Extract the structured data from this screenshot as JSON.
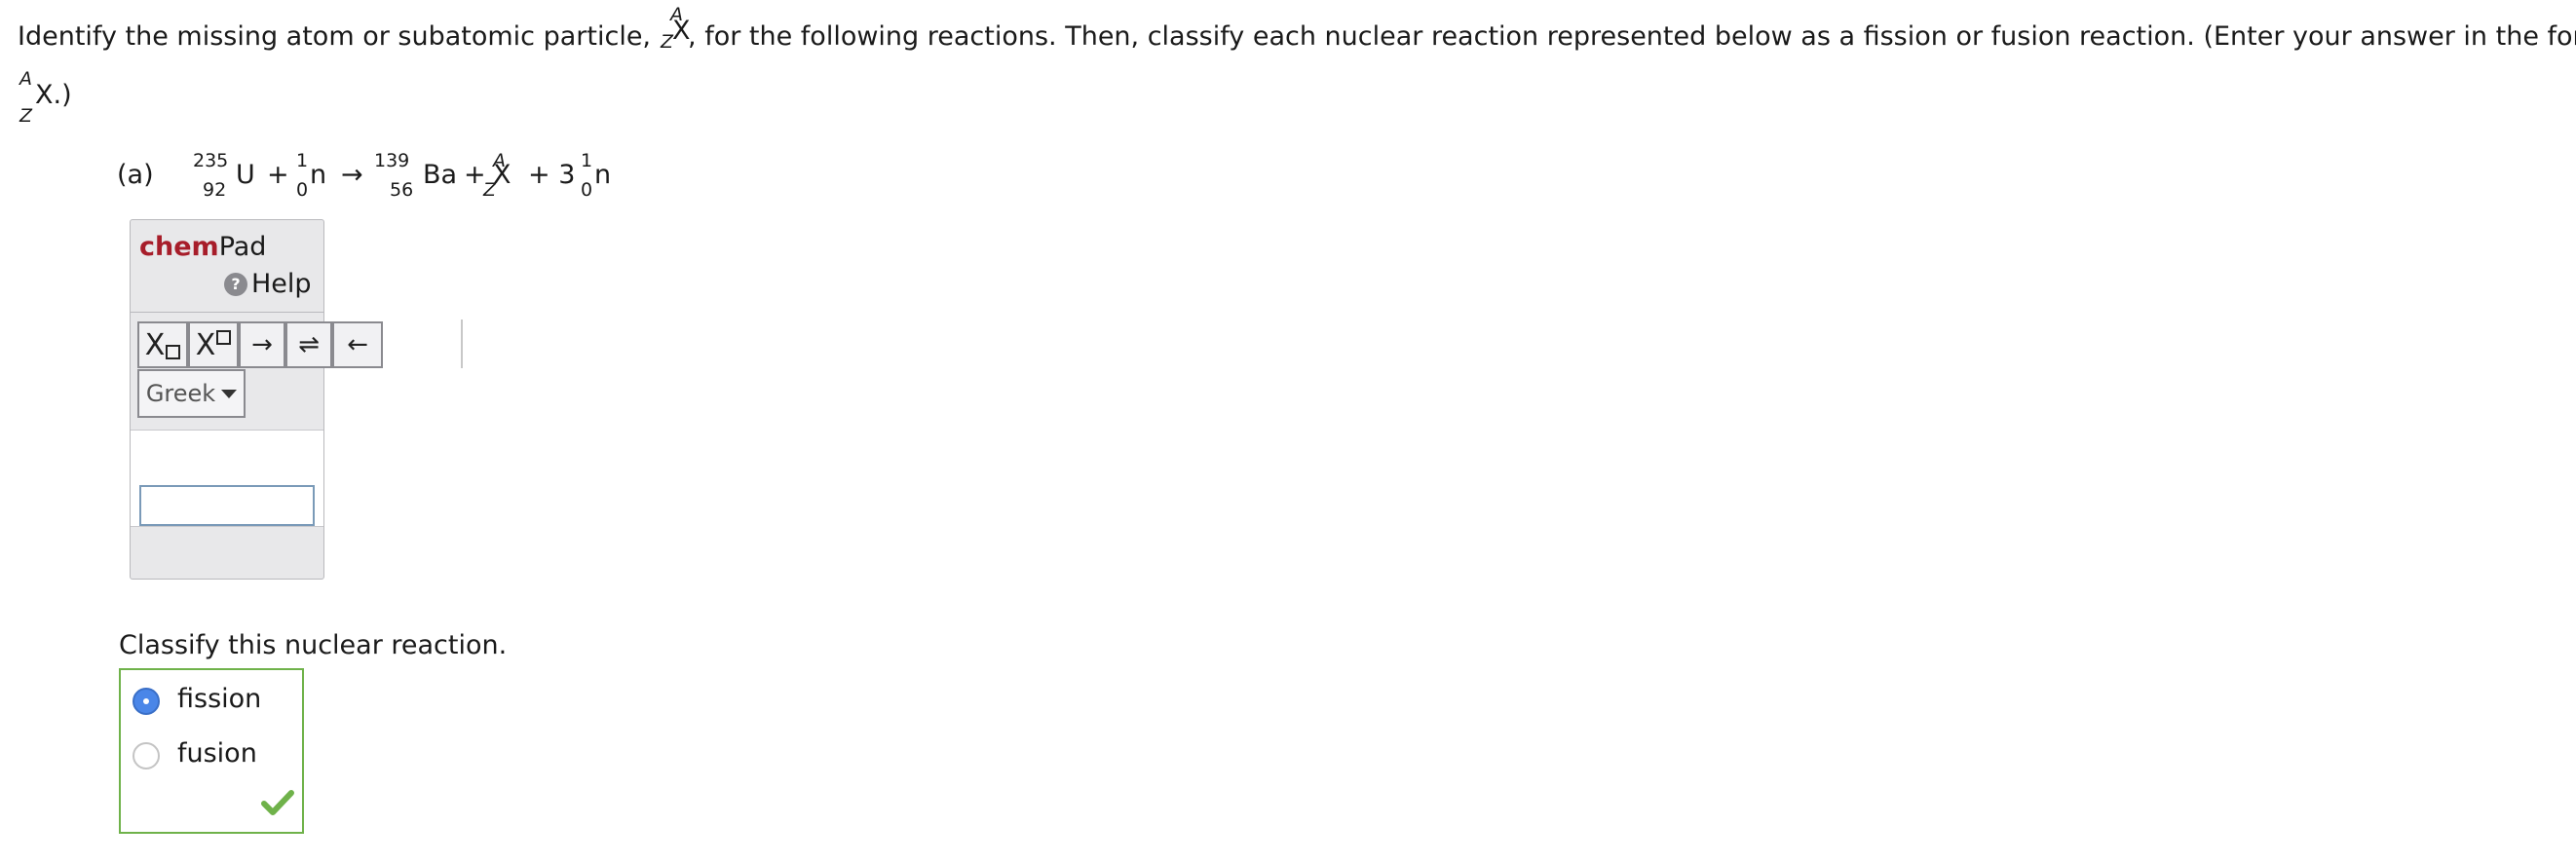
{
  "instructions": {
    "part1": "Identify the missing atom or subatomic particle,",
    "unknown_mass": "A",
    "unknown_number": "Z",
    "unknown_symbol": "X",
    "part2": ", for the following reactions. Then, classify each nuclear reaction represented below as a fission or fusion reaction. (Enter your answer in the form",
    "form_mass": "A",
    "form_number": "Z",
    "form_symbol": "X.)"
  },
  "reaction": {
    "label": "(a)",
    "u_mass": "235",
    "u_number": "92",
    "u_symbol": "U",
    "plus1": "+",
    "n1_mass": "1",
    "n1_number": "0",
    "n1_symbol": "n",
    "arrow": "→",
    "ba_mass": "139",
    "ba_number": "56",
    "ba_symbol": "Ba",
    "plus2": "+",
    "x_mass": "A",
    "x_number": "Z",
    "x_symbol": "X",
    "plus3": "+ 3",
    "n2_mass": "1",
    "n2_number": "0",
    "n2_symbol": "n"
  },
  "chempad": {
    "brand_bold": "chem",
    "brand_rest": "Pad",
    "help_label": "Help",
    "help_icon": "question-circle-icon",
    "toolbar": {
      "subscript": "X",
      "superscript": "X",
      "arrow_right": "→",
      "equilibrium": "⇌",
      "arrow_left": "←"
    },
    "greek_label": "Greek",
    "answer_value": ""
  },
  "classify": {
    "prompt": "Classify this nuclear reaction.",
    "options": [
      {
        "label": "fission",
        "selected": true
      },
      {
        "label": "fusion",
        "selected": false
      }
    ],
    "status_icon": "checkmark-icon",
    "status_color": "#6fb24a"
  },
  "colors": {
    "brand_red": "#a71d2a",
    "radio_selected": "#4a86e8",
    "correct_border": "#6fb24a"
  }
}
